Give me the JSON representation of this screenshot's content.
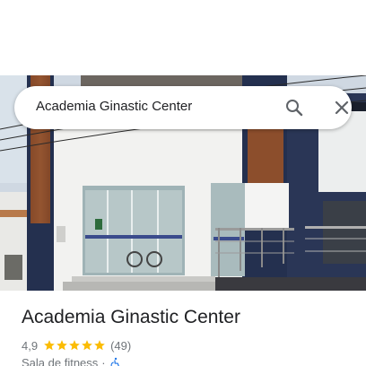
{
  "search": {
    "query": "Academia Ginastic Center",
    "search_icon": "search-icon",
    "close_icon": "close-icon"
  },
  "place": {
    "name": "Academia Ginastic Center",
    "rating": "4,9",
    "stars": 5,
    "reviews": "(49)",
    "category": "Sala de fitness",
    "separator": "·",
    "accessibility_icon": "wheelchair-icon"
  },
  "colors": {
    "star": "#fbbc04",
    "accessibility": "#1a73e8",
    "text_primary": "#202124",
    "text_secondary": "#70757a",
    "icon": "#5f6368"
  }
}
